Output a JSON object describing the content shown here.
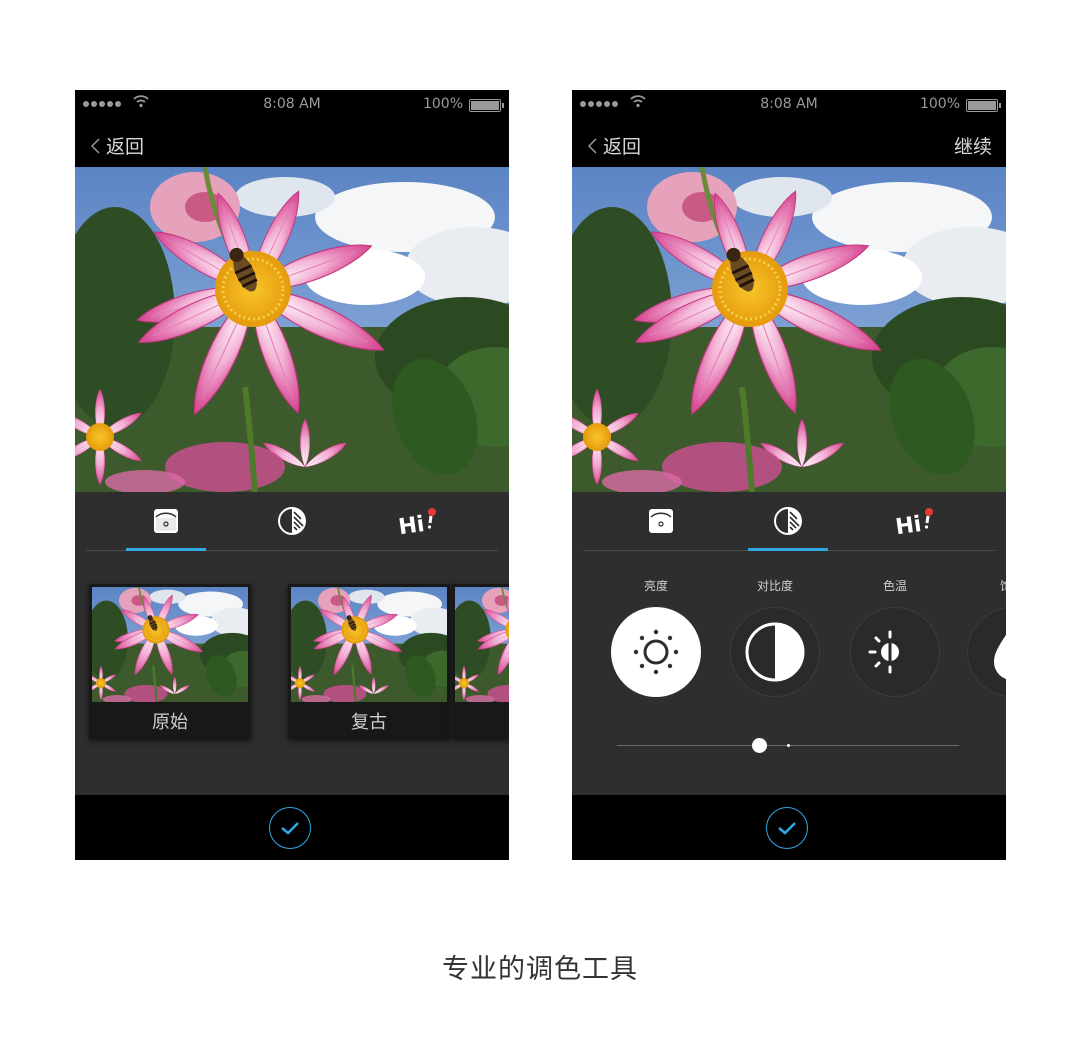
{
  "status": {
    "time": "8:08 AM",
    "battery": "100%"
  },
  "nav": {
    "back_label": "返回",
    "continue_label": "继续"
  },
  "tabs": [
    {
      "name": "filters",
      "icon": "filter-card-icon"
    },
    {
      "name": "adjust",
      "icon": "contrast-icon"
    },
    {
      "name": "fun",
      "icon": "hi-sticker-icon",
      "text": "Hi"
    }
  ],
  "left_screen": {
    "active_tab": "filters",
    "filters": [
      {
        "label": "原始"
      },
      {
        "label": "复古"
      }
    ]
  },
  "right_screen": {
    "active_tab": "adjust",
    "adjustments": [
      {
        "label": "亮度",
        "icon": "brightness-icon",
        "selected": true
      },
      {
        "label": "对比度",
        "icon": "contrast-icon",
        "selected": false
      },
      {
        "label": "色温",
        "icon": "color-temperature-icon",
        "selected": false
      },
      {
        "label": "饱和",
        "icon": "saturation-icon",
        "selected": false
      }
    ],
    "slider_value": 0.4
  },
  "confirm_icon": "checkmark-icon",
  "colors": {
    "accent": "#2fa9e3",
    "panel": "#2e2e2e",
    "bar": "#000000",
    "hi_dot": "#e53935"
  },
  "caption": "专业的调色工具"
}
